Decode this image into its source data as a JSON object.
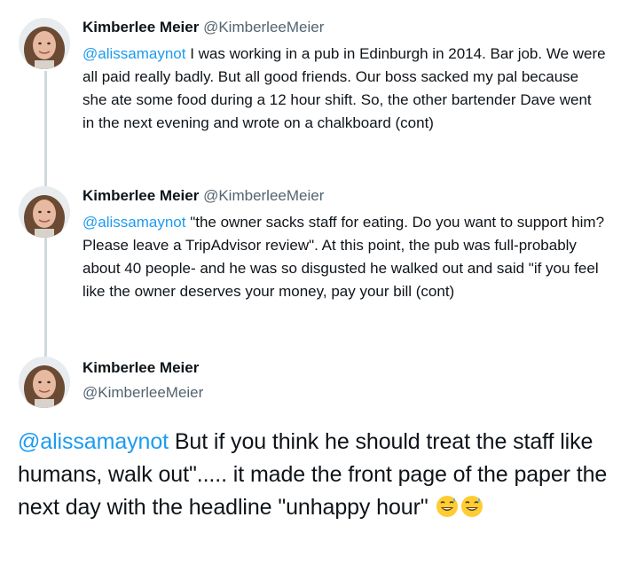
{
  "colors": {
    "mention": "#1d9bf0",
    "handle": "#536471",
    "text": "#0f1419",
    "thread_line": "#cfd9de"
  },
  "tweets": [
    {
      "name": "Kimberlee Meier",
      "handle": "@KimberleeMeier",
      "mention": "@alissamaynot",
      "text": " I was working in a pub in Edinburgh in 2014. Bar job. We were all paid really badly. But all good friends. Our boss sacked my pal because she ate some food during a 12 hour shift. So, the other bartender Dave went in the next evening and wrote on a chalkboard (cont)"
    },
    {
      "name": "Kimberlee Meier",
      "handle": "@KimberleeMeier",
      "mention": "@alissamaynot",
      "text": " \"the owner sacks staff for eating. Do you want to support him? Please leave a TripAdvisor review\". At this point, the pub was full-probably about 40 people- and he was so disgusted he walked out and said \"if you feel like the owner deserves your money, pay your bill (cont)"
    }
  ],
  "main_tweet": {
    "name": "Kimberlee Meier",
    "handle": "@KimberleeMeier",
    "mention": "@alissamaynot",
    "text": " But if you think he should treat the staff like humans, walk out\"..... it made the front page of the paper the next day with the headline \"unhappy hour\"",
    "emojis": [
      "grinning-sweat-emoji",
      "grinning-sweat-emoji"
    ]
  }
}
